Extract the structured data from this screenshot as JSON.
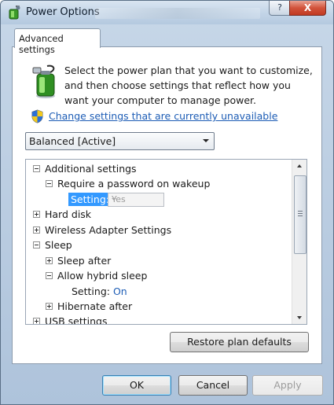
{
  "window": {
    "title": "Power Options",
    "help_label": "?",
    "close_label": "X"
  },
  "tabs": [
    {
      "label": "Advanced settings"
    }
  ],
  "intro": {
    "text": "Select the power plan that you want to customize, and then choose settings that reflect how you want your computer to manage power."
  },
  "change_link": {
    "label": "Change settings that are currently unavailable"
  },
  "plan_select": {
    "value": "Balanced [Active]"
  },
  "tree": {
    "additional_settings": "Additional settings",
    "require_password": "Require a password on wakeup",
    "require_password_setting_label": "Setting:",
    "require_password_setting_value": "Yes",
    "hard_disk": "Hard disk",
    "wireless": "Wireless Adapter Settings",
    "sleep": "Sleep",
    "sleep_after": "Sleep after",
    "hybrid_sleep": "Allow hybrid sleep",
    "hybrid_setting_label": "Setting:",
    "hybrid_setting_value": "On",
    "hibernate_after": "Hibernate after",
    "usb": "USB settings"
  },
  "buttons": {
    "restore": "Restore plan defaults",
    "ok": "OK",
    "cancel": "Cancel",
    "apply": "Apply"
  },
  "icons": {
    "title": "power-plan-icon",
    "plan": "battery-plug-icon",
    "shield": "uac-shield-icon"
  },
  "colors": {
    "link": "#1c5cb5",
    "selection": "#3399ff",
    "close": "#c13a22"
  }
}
